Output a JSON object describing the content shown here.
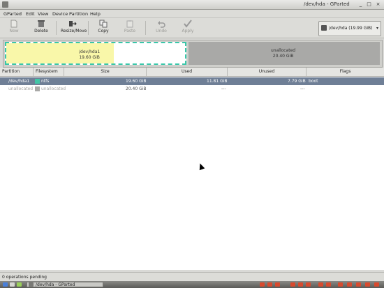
{
  "window": {
    "title": "/dev/hda - GParted",
    "buttons": {
      "minimize": "_",
      "maximize": "□",
      "close": "×"
    }
  },
  "menu": [
    "GParted",
    "Edit",
    "View",
    "Device",
    "Partition",
    "Help"
  ],
  "toolbar": {
    "new": "New",
    "delete": "Delete",
    "resize_move": "Resize/Move",
    "copy": "Copy",
    "paste": "Paste",
    "undo": "Undo",
    "apply": "Apply"
  },
  "device_selector": {
    "value": "/dev/hda  (19.99 GiB)",
    "arrow": "▾"
  },
  "diskmap": {
    "partition": {
      "name": "/dev/hda1",
      "size": "19.60 GiB",
      "used_fraction": 0.6
    },
    "unallocated": {
      "name": "unallocated",
      "size": "20.40 GiB"
    }
  },
  "table": {
    "headers": [
      "Partition",
      "Filesystem",
      "Size",
      "Used",
      "Unused",
      "Flags"
    ],
    "rows": [
      {
        "partition": "/dev/hda1",
        "filesystem": "ntfs",
        "size": "19.60 GiB",
        "used": "11.81 GiB",
        "unused": "7.79 GiB",
        "flags": "boot",
        "color": "#42c6a6"
      },
      {
        "partition": "unallocated",
        "filesystem": "unallocated",
        "size": "20.40 GiB",
        "used": "---",
        "unused": "---",
        "flags": "",
        "color": "#a9a9a7"
      }
    ]
  },
  "status": "0 operations pending",
  "taskbar": {
    "task": "/dev/hda - GParted"
  },
  "colors": {
    "selection": "#6f7f96",
    "ntfs": "#42c6a6",
    "used": "#f9f7a9",
    "unallocated": "#a9a9a7"
  }
}
